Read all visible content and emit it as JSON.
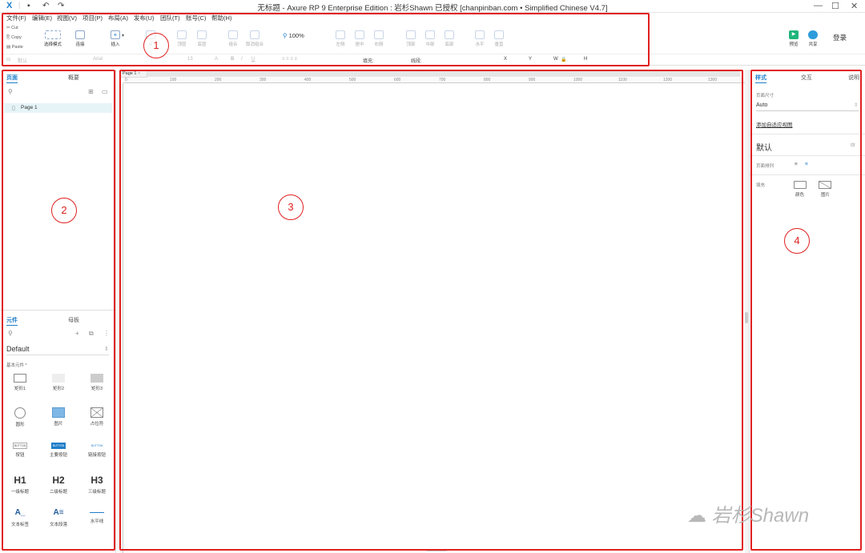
{
  "window": {
    "title": "无标题 - Axure RP 9 Enterprise Edition : 岩杉Shawn 已授权   [chanpinban.com • Simplified Chinese V4.7]",
    "app_icon": "X",
    "quick_access": [
      "save-icon",
      "undo-icon",
      "redo-icon"
    ],
    "controls": {
      "minimize": "—",
      "maximize": "☐",
      "close": "✕"
    }
  },
  "menubar": [
    "文件(F)",
    "编辑(E)",
    "视图(V)",
    "项目(P)",
    "布局(A)",
    "发布(U)",
    "团队(T)",
    "账号(C)",
    "帮助(H)"
  ],
  "clipboard": {
    "cut": "Cut",
    "copy": "Copy",
    "paste": "Paste"
  },
  "toolbar": {
    "select_mode": "选择模式",
    "connect": "连接",
    "insert": "插入",
    "point": "点",
    "top": "顶层",
    "bottom": "底层",
    "group": "组合",
    "ungroup": "取消组合",
    "zoom": "100%",
    "left": "左侧",
    "center": "居中",
    "right": "右侧",
    "top_align": "顶部",
    "middle": "中部",
    "bottom_align": "底部",
    "horizontal": "水平",
    "vertical": "垂直",
    "preview": "预览",
    "share": "共享",
    "login": "登录"
  },
  "format": {
    "style": "默认",
    "font": "Arial",
    "size": "13",
    "fill_label": "填充:",
    "stroke_label": "线段:",
    "x": "X",
    "y": "Y",
    "w": "W",
    "h": "H"
  },
  "left_panel": {
    "pages_tab": "页面",
    "outline_tab": "概要",
    "page_item": "Page 1",
    "widgets_tab": "元件",
    "masters_tab": "母板",
    "library": "Default",
    "category": "基本元件 *",
    "widgets": [
      {
        "name": "矩形1",
        "icon": "rect-outline"
      },
      {
        "name": "矩形2",
        "icon": "rect-light"
      },
      {
        "name": "矩形3",
        "icon": "rect-gray"
      },
      {
        "name": "圆形",
        "icon": "circle"
      },
      {
        "name": "图片",
        "icon": "image"
      },
      {
        "name": "占位符",
        "icon": "placeholder"
      },
      {
        "name": "按钮",
        "icon": "button-plain",
        "text": "BUTTON"
      },
      {
        "name": "主要按钮",
        "icon": "button-primary",
        "text": "BUTTON"
      },
      {
        "name": "链接按钮",
        "icon": "button-link",
        "text": "BUTTON"
      },
      {
        "name": "一级标题",
        "icon": "h1",
        "text": "H1"
      },
      {
        "name": "二级标题",
        "icon": "h2",
        "text": "H2"
      },
      {
        "name": "三级标题",
        "icon": "h3",
        "text": "H3"
      },
      {
        "name": "文本标签",
        "icon": "text-label",
        "text": "A_"
      },
      {
        "name": "文本段落",
        "icon": "text-paragraph",
        "text": "A≡"
      },
      {
        "name": "水平线",
        "icon": "horizontal-line"
      }
    ]
  },
  "canvas": {
    "tab": "Page 1",
    "ruler_marks": [
      "0",
      "100",
      "200",
      "300",
      "400",
      "500",
      "600",
      "700",
      "800",
      "900",
      "1000",
      "1100",
      "1200",
      "1300"
    ]
  },
  "right_panel": {
    "style_tab": "样式",
    "interact_tab": "交互",
    "notes_tab": "说明",
    "page_size_label": "页面尺寸",
    "page_size": "Auto",
    "adaptive_link": "添加自适应视图",
    "default_label": "默认",
    "align_label": "页面排列",
    "fill_label": "填充",
    "fill_color": "颜色",
    "fill_image": "图片"
  },
  "annotations": [
    "1",
    "2",
    "3",
    "4"
  ],
  "watermark": "岩杉Shawn",
  "colors": {
    "accent": "#1f7ec9",
    "annotation": "#e02020",
    "preview": "#1fb57a",
    "share": "#2d9cdb",
    "selected_page": "#e6f4f8"
  }
}
